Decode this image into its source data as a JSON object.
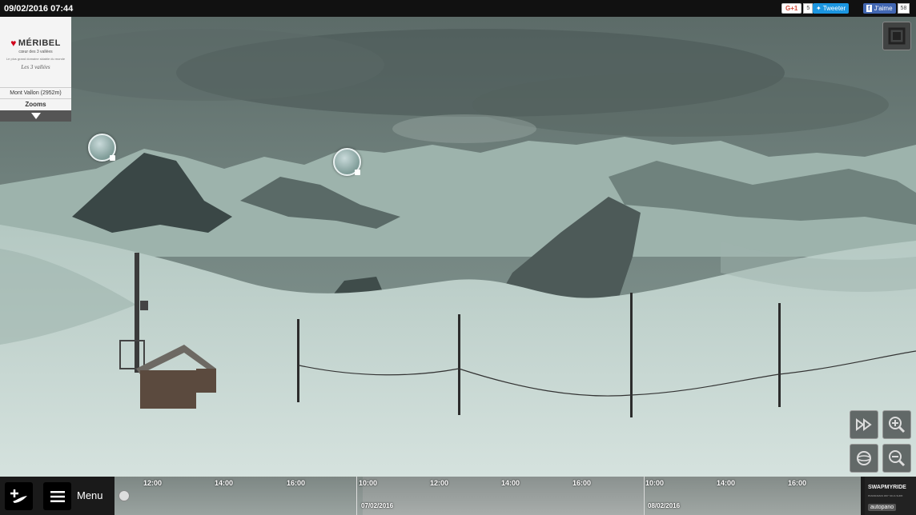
{
  "header": {
    "datetime": "09/02/2016 07:44"
  },
  "social": {
    "gplus_label": "G+1",
    "gplus_count": "5",
    "twitter_label": "Tweeter",
    "facebook_label": "J'aime",
    "facebook_count": "58"
  },
  "logo": {
    "brand": "MÉRIBEL",
    "subtitle": "cœur des 3 vallées",
    "tagline": "Le plus grand domaine skiable du monde",
    "partner": "Les 3 vallées"
  },
  "camera": {
    "location": "Mont Vallon (2952m)",
    "zooms_label": "Zooms"
  },
  "menu": {
    "label": "Menu"
  },
  "timeline": {
    "times": [
      "12:00",
      "14:00",
      "16:00",
      "10:00",
      "12:00",
      "14:00",
      "16:00",
      "10:00",
      "14:00",
      "16:00"
    ],
    "dates": [
      "07/02/2016",
      "08/02/2016"
    ]
  },
  "branding": {
    "swapmyride": "SWAPMYRIDE",
    "swap_sub": "PANORAMAS 360° SKI & SURF",
    "autopano": "autopano"
  },
  "colors": {
    "sky": "#6e7f7b",
    "snow": "#c9d9d4",
    "twitter": "#1b95e0",
    "facebook": "#4267b2",
    "gplus": "#d34836"
  }
}
